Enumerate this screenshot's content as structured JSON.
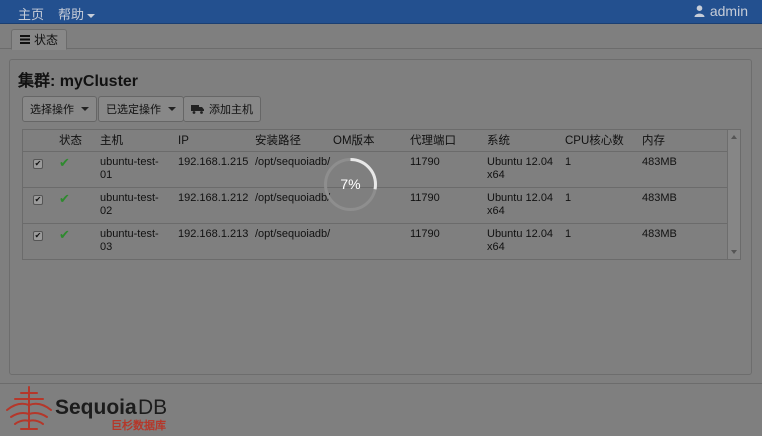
{
  "nav": {
    "home": "主页",
    "help": "帮助",
    "user": "admin"
  },
  "tab": {
    "label": "状态"
  },
  "cluster": {
    "title": "集群: myCluster"
  },
  "toolbar": {
    "select_ops": "选择操作",
    "selected_ops": "已选定操作",
    "add_host": "添加主机"
  },
  "table": {
    "headers": {
      "status": "状态",
      "host": "主机",
      "ip": "IP",
      "path": "安装路径",
      "om": "OM版本",
      "port": "代理端口",
      "os": "系统",
      "cpu": "CPU核心数",
      "mem": "内存"
    },
    "rows": [
      {
        "checked": true,
        "status": "ok",
        "host": "ubuntu-test-01",
        "ip": "192.168.1.215",
        "path": "/opt/sequoiadb/",
        "om": "",
        "port": "11790",
        "os": "Ubuntu 12.04 x64",
        "cpu": "1",
        "mem": "483MB"
      },
      {
        "checked": true,
        "status": "ok",
        "host": "ubuntu-test-02",
        "ip": "192.168.1.212",
        "path": "/opt/sequoiadb/",
        "om": "",
        "port": "11790",
        "os": "Ubuntu 12.04 x64",
        "cpu": "1",
        "mem": "483MB"
      },
      {
        "checked": true,
        "status": "ok",
        "host": "ubuntu-test-03",
        "ip": "192.168.1.213",
        "path": "/opt/sequoiadb/",
        "om": "",
        "port": "11790",
        "os": "Ubuntu 12.04 x64",
        "cpu": "1",
        "mem": "483MB"
      }
    ]
  },
  "loading": {
    "text": "7%",
    "progress": 0.07
  },
  "brand": {
    "name_main": "Sequoia",
    "name_suffix": "DB",
    "tagline": "巨杉数据库",
    "color_red": "#b5372a",
    "color_dark": "#1c1c1c"
  },
  "colors": {
    "navbar": "#23508f",
    "check": "#2e8a2e",
    "overlay": "#7f7f7f"
  }
}
